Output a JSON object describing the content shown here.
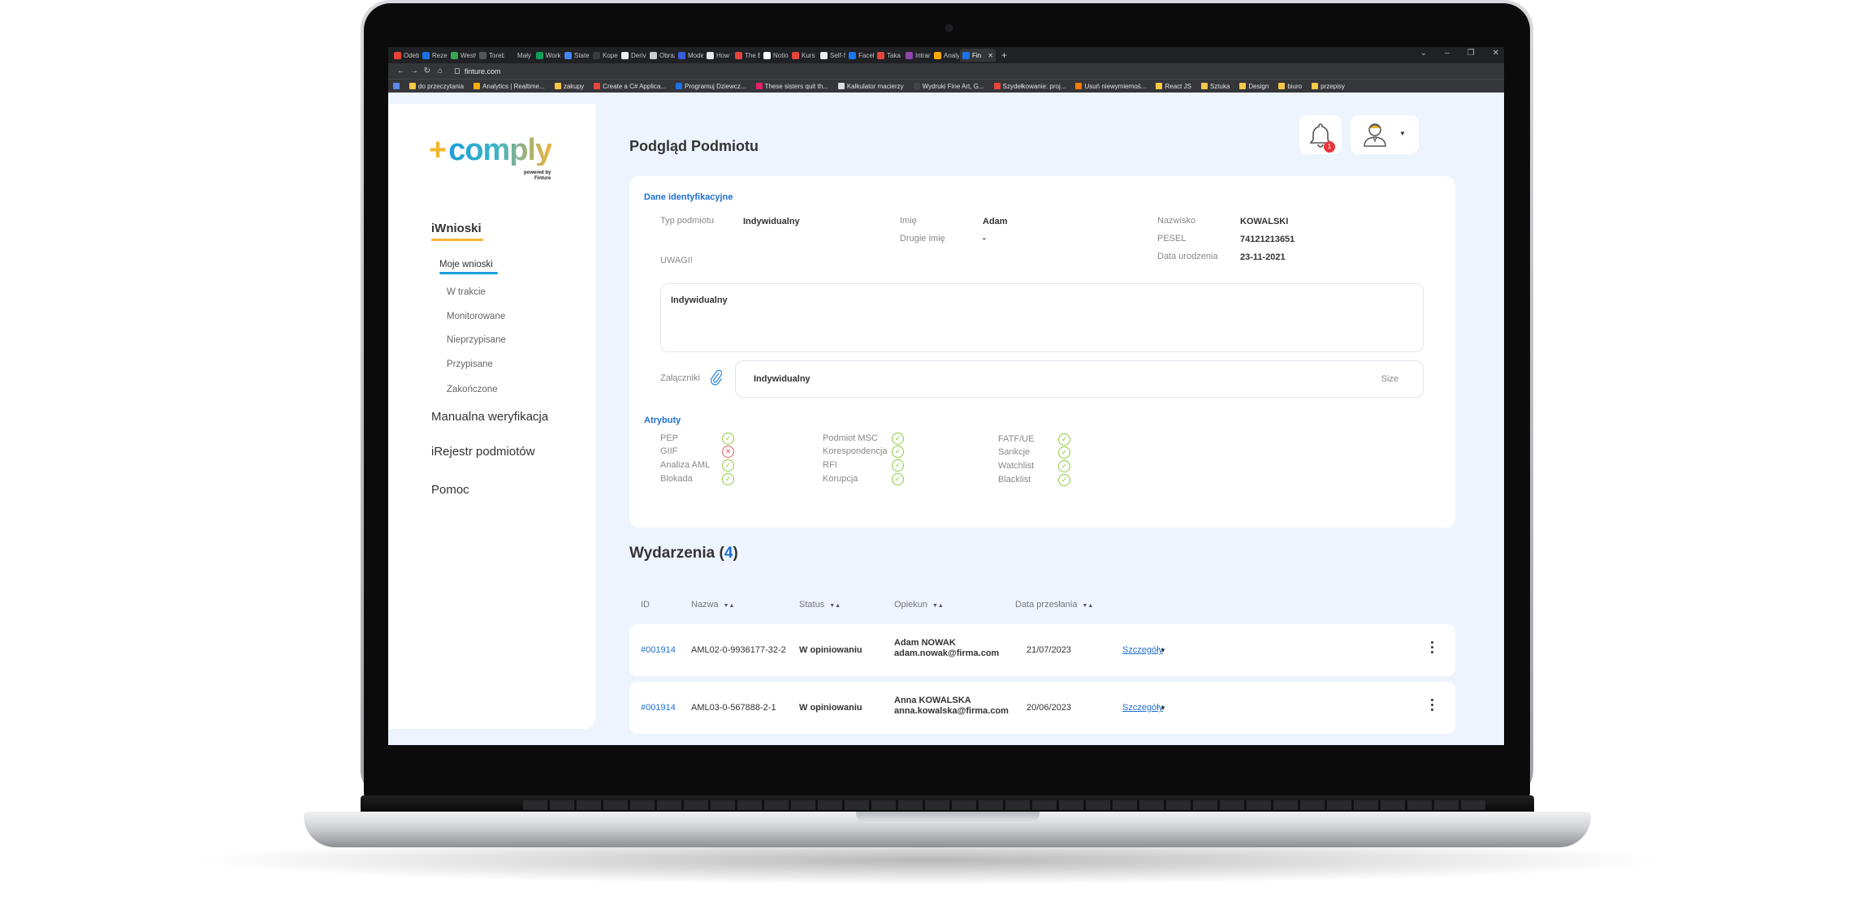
{
  "browser": {
    "tabs": [
      {
        "label": "Odebr",
        "color": "#ea4335"
      },
      {
        "label": "Rezerv",
        "color": "#1a73e8"
      },
      {
        "label": "Westw",
        "color": "#34a853"
      },
      {
        "label": "Torebk",
        "color": "#555555"
      },
      {
        "label": "Mały p",
        "color": "#222222"
      },
      {
        "label": "Works",
        "color": "#0f9d58"
      },
      {
        "label": "Staten",
        "color": "#4285f4"
      },
      {
        "label": "Koperi",
        "color": "#3b3b3b"
      },
      {
        "label": "Deriva",
        "color": "#eeeeee"
      },
      {
        "label": "Obraz",
        "color": "#cccccc"
      },
      {
        "label": "Model",
        "color": "#3b5bdb"
      },
      {
        "label": "How to",
        "color": "#e8e8e8"
      },
      {
        "label": "The Br",
        "color": "#e8453c"
      },
      {
        "label": "Notion",
        "color": "#ffffff"
      },
      {
        "label": "Kurs o",
        "color": "#e8453c"
      },
      {
        "label": "Self-Sa",
        "color": "#eeeeee"
      },
      {
        "label": "Faceb",
        "color": "#1877f2"
      },
      {
        "label": "Taka p",
        "color": "#e8453c"
      },
      {
        "label": "Intran",
        "color": "#8e44ad"
      },
      {
        "label": "Analyt",
        "color": "#f9ab00"
      },
      {
        "label": "Fin",
        "color": "#1a73e8",
        "active": true
      }
    ],
    "url": "finture.com",
    "bookmarks": [
      {
        "label": "do przeczytania",
        "color": "#f6c945"
      },
      {
        "label": "Analytics | Realtime...",
        "color": "#f9ab00"
      },
      {
        "label": "zakupy",
        "color": "#f6c945"
      },
      {
        "label": "Create a C# Applica...",
        "color": "#e8453c"
      },
      {
        "label": "Programuj Dziewcz...",
        "color": "#1a73e8"
      },
      {
        "label": "These sisters quit th...",
        "color": "#e91e63"
      },
      {
        "label": "Kalkulator macierzy",
        "color": "#dddddd"
      },
      {
        "label": "Wydruki Fine Art, G...",
        "color": "#444444"
      },
      {
        "label": "Szydełkowanie: proj...",
        "color": "#e8453c"
      },
      {
        "label": "Usuń niewymiemoś...",
        "color": "#f57c00"
      },
      {
        "label": "React JS",
        "color": "#f6c945"
      },
      {
        "label": "Sztuka",
        "color": "#f6c945"
      },
      {
        "label": "Design",
        "color": "#f6c945"
      },
      {
        "label": "biuro",
        "color": "#f6c945"
      },
      {
        "label": "przepisy",
        "color": "#f6c945"
      }
    ]
  },
  "sidebar": {
    "logo": "comply",
    "logo_powered": "powered by",
    "logo_company": "Finture",
    "section": "iWnioski",
    "active_item": "Moje wnioski",
    "items": [
      "W trakcie",
      "Monitorowane",
      "Nieprzypisane",
      "Przypisane",
      "Zakończone"
    ],
    "main_items": [
      "Manualna weryfikacja",
      "iRejestr podmiotów",
      "Pomoc"
    ]
  },
  "header": {
    "title": "Podgląd Podmiotu",
    "notification_count": "1"
  },
  "identification": {
    "section_title": "Dane identyfikacyjne",
    "typ_label": "Typ podmiotu",
    "typ_value": "Indywidualny",
    "imie_label": "Imię",
    "imie_value": "Adam",
    "drugie_label": "Drugie imię",
    "drugie_value": "-",
    "nazwisko_label": "Nazwisko",
    "nazwisko_value": "KOWALSKI",
    "pesel_label": "PESEL",
    "pesel_value": "74121213651",
    "data_label": "Data urodzenia",
    "data_value": "23-11-2021",
    "uwagi_label": "UWAGI!",
    "uwagi_value": "Indywidualny",
    "zalaczniki_label": "Załączniki",
    "attachment_name": "Indywidualny",
    "attachment_size": "Size"
  },
  "attributes": {
    "section_title": "Atrybuty",
    "col1": [
      {
        "label": "PEP",
        "status": "ok"
      },
      {
        "label": "GIIF",
        "status": "fail"
      },
      {
        "label": "Analiza AML",
        "status": "ok"
      },
      {
        "label": "Blokada",
        "status": "ok"
      }
    ],
    "col2": [
      {
        "label": "Podmiot MSC",
        "status": "ok"
      },
      {
        "label": "Korespondencja",
        "status": "ok"
      },
      {
        "label": "RFI",
        "status": "ok"
      },
      {
        "label": "Korupcja",
        "status": "ok"
      }
    ],
    "col3": [
      {
        "label": "FATF/UE",
        "status": "ok"
      },
      {
        "label": "Sankcje",
        "status": "ok"
      },
      {
        "label": "Watchlist",
        "status": "ok"
      },
      {
        "label": "Blacklist",
        "status": "ok"
      }
    ]
  },
  "events": {
    "title": "Wydarzenia",
    "count": "4",
    "columns": {
      "id": "ID",
      "nazwa": "Nazwa",
      "status": "Status",
      "opiekun": "Opiekun",
      "data": "Data przesłania"
    },
    "rows": [
      {
        "id": "#001914",
        "nazwa": "AML02-0-9936177-32-2",
        "status": "W opiniowaniu",
        "opiekun_name": "Adam NOWAK",
        "opiekun_email": "adam.nowak@firma.com",
        "data": "21/07/2023",
        "action": "Szczegóły"
      },
      {
        "id": "#001914",
        "nazwa": "AML03-0-567888-2-1",
        "status": "W opiniowaniu",
        "opiekun_name": "Anna KOWALSKA",
        "opiekun_email": "anna.kowalska@firma.com",
        "data": "20/06/2023",
        "action": "Szczegóły"
      }
    ]
  },
  "colors": {
    "accent_blue": "#1d6fd1",
    "accent_yellow": "#f2b632",
    "ok_green": "#8dca3c",
    "fail_red": "#e35a5f",
    "background": "#eef4fd"
  }
}
